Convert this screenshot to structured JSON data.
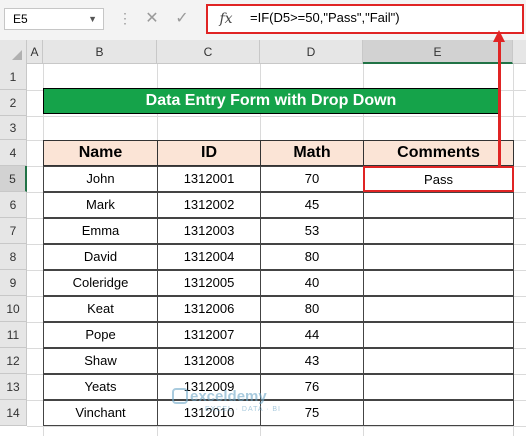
{
  "formula_bar": {
    "name_box": "E5",
    "cancel": "✕",
    "enter": "✓",
    "fx": "fx",
    "formula": "=IF(D5>=50,\"Pass\",\"Fail\")"
  },
  "columns": [
    "A",
    "B",
    "C",
    "D",
    "E"
  ],
  "rows": [
    "1",
    "2",
    "3",
    "4",
    "5",
    "6",
    "7",
    "8",
    "9",
    "10",
    "11",
    "12",
    "13",
    "14"
  ],
  "title": "Data Entry Form with Drop Down",
  "table": {
    "headers": [
      "Name",
      "ID",
      "Math",
      "Comments"
    ],
    "rows": [
      [
        "John",
        "1312001",
        "70",
        "Pass"
      ],
      [
        "Mark",
        "1312002",
        "45",
        ""
      ],
      [
        "Emma",
        "1312003",
        "53",
        ""
      ],
      [
        "David",
        "1312004",
        "80",
        ""
      ],
      [
        "Coleridge",
        "1312005",
        "40",
        ""
      ],
      [
        "Keat",
        "1312006",
        "80",
        ""
      ],
      [
        "Pope",
        "1312007",
        "44",
        ""
      ],
      [
        "Shaw",
        "1312008",
        "43",
        ""
      ],
      [
        "Yeats",
        "1312009",
        "76",
        ""
      ],
      [
        "Vinchant",
        "1312010",
        "75",
        ""
      ]
    ]
  },
  "watermark": {
    "name": "exceldemy",
    "tagline": "EXCEL · DATA · BI"
  },
  "colors": {
    "title_bg": "#15a34a",
    "header_bg": "#fbe4d6",
    "highlight": "#e02424"
  }
}
